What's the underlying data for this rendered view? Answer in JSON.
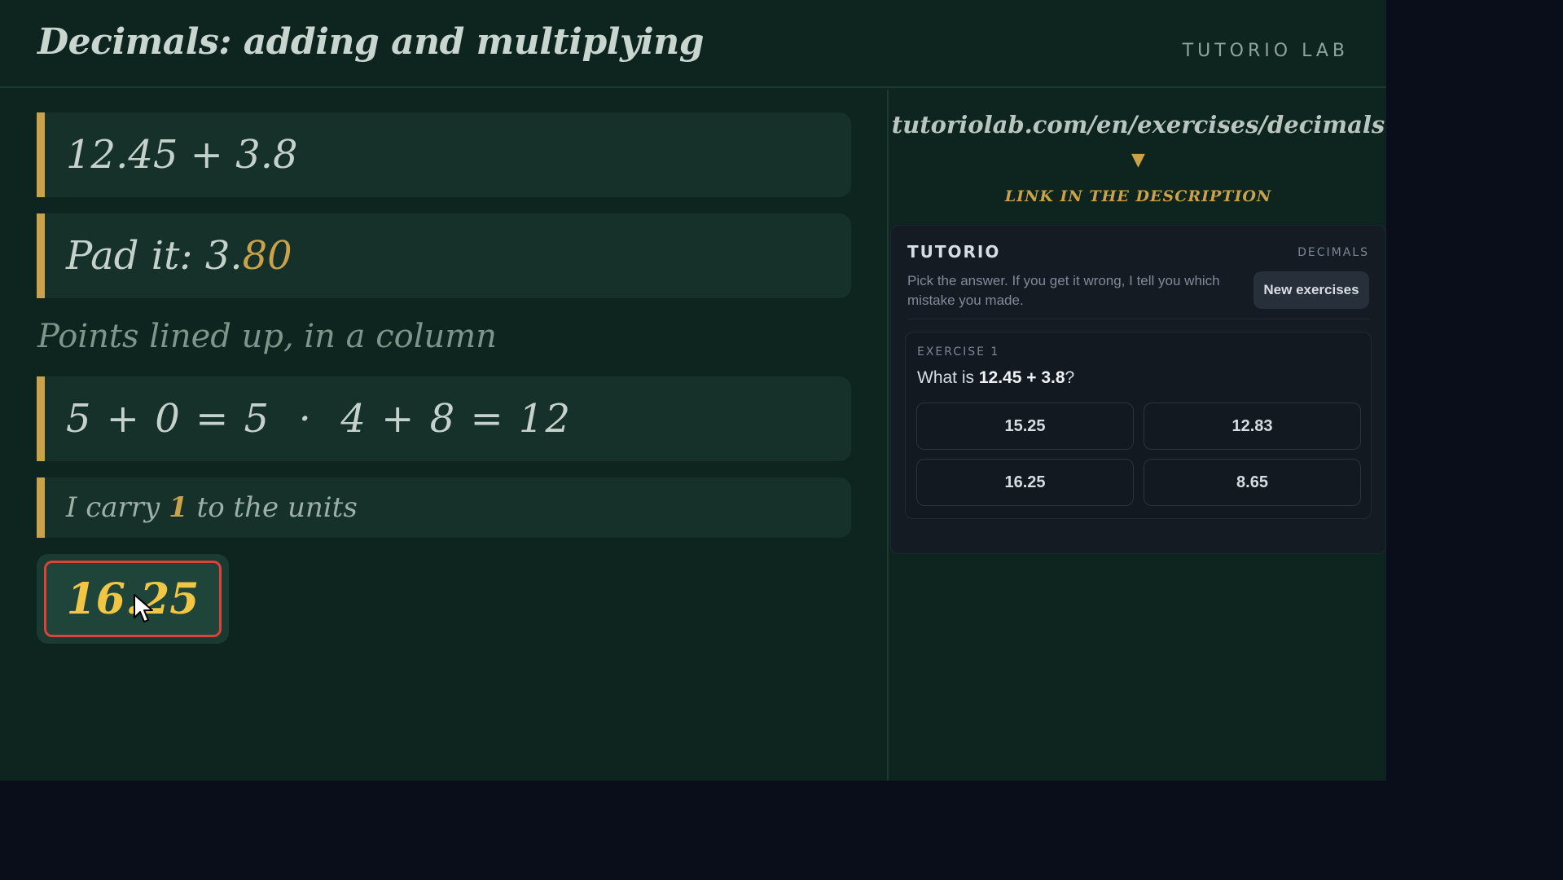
{
  "header": {
    "title": "Decimals: adding and multiplying",
    "brand": "TUTORIO LAB"
  },
  "board": {
    "step1": "12.45 + 3.8",
    "step2_prefix": "Pad it: 3.",
    "step2_highlight": "80",
    "note": "Points lined up, in a column",
    "step4": "5 + 0 = 5  ·  4 + 8 = 12",
    "step5_prefix": "I carry ",
    "step5_highlight": "1",
    "step5_suffix": " to the units",
    "answer": "16.25"
  },
  "promo": {
    "url": "tutoriolab.com/en/exercises/decimals",
    "arrow": "▼",
    "cta": "LINK IN THE DESCRIPTION"
  },
  "widget": {
    "brand": "TUTORIO",
    "tag": "DECIMALS",
    "description": "Pick the answer. If you get it wrong, I tell you which mistake you made.",
    "new_button": "New exercises",
    "exercise": {
      "label": "EXERCISE 1",
      "question_prefix": "What is ",
      "question_expr": "12.45 + 3.8",
      "question_suffix": "?",
      "options": [
        "15.25",
        "12.83",
        "16.25",
        "8.65"
      ]
    }
  },
  "colors": {
    "board_bg": "#0e241e",
    "accent_gold": "#c9a24a",
    "answer_text": "#f1c644",
    "answer_border": "#d9443a",
    "widget_bg": "#151b23",
    "page_bg": "#0a0e1a"
  },
  "icons": {
    "cursor": "mouse-pointer-icon"
  }
}
